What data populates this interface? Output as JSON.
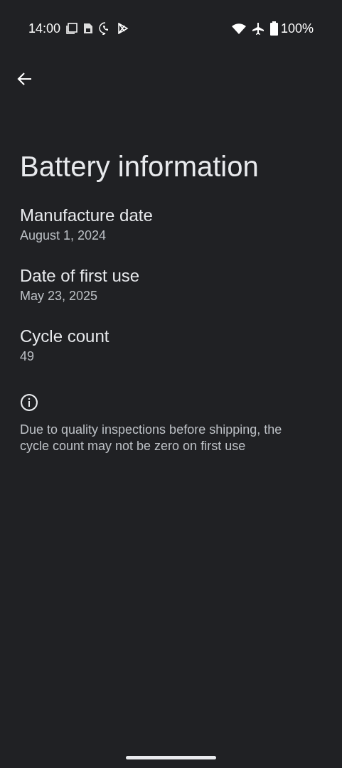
{
  "status_bar": {
    "time": "14:00",
    "battery": "100%"
  },
  "title": "Battery information",
  "items": [
    {
      "label": "Manufacture date",
      "value": "August 1, 2024"
    },
    {
      "label": "Date of first use",
      "value": "May 23, 2025"
    },
    {
      "label": "Cycle count",
      "value": "49"
    }
  ],
  "footer_note": "Due to quality inspections before shipping, the cycle count may not be zero on first use"
}
